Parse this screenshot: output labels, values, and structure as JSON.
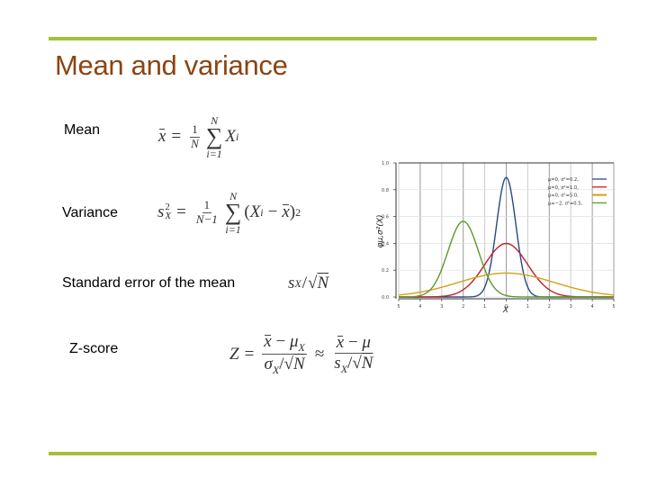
{
  "slide": {
    "title": "Mean and variance",
    "accent_color": "#a3c03c",
    "title_color": "#8b4513"
  },
  "items": [
    {
      "label": "Mean",
      "formula": "x̄ = (1/N) Σ_{i=1}^{N} X_i"
    },
    {
      "label": "Variance",
      "formula": "s_X^2 = (1/(N−1)) Σ_{i=1}^{N} (X_i − x̄)^2"
    },
    {
      "label": "Standard error of the mean",
      "formula": "s_X/√N"
    },
    {
      "label": "Z-score",
      "formula": "Z = (x̄ − μ_X)/(σ_X/√N) ≈ (x̄ − μ)/(s_X/√N)"
    }
  ],
  "formula_parts": {
    "xbar": "x",
    "eq": "=",
    "one": "1",
    "N": "N",
    "Nm1": "N−1",
    "sum_lower": "i=1",
    "sum_upper": "N",
    "sigma": "∑",
    "X": "X",
    "i": "i",
    "s": "s",
    "two": "2",
    "minus": "−",
    "lparen": "(",
    "rparen": ")",
    "slash": "/",
    "sqrt": "√",
    "Z": "Z",
    "mu": "μ",
    "sigma_lower": "σ",
    "approx": "≈"
  },
  "chart_data": {
    "type": "line",
    "title": "",
    "xlabel": "X",
    "ylabel": "φμ,σ²(X)",
    "xlim": [
      -5,
      5
    ],
    "ylim": [
      0.0,
      1.0
    ],
    "xticks": [
      -5,
      -4,
      -3,
      -2,
      -1,
      0,
      1,
      2,
      3,
      4,
      5
    ],
    "xtick_labels": [
      "5",
      "4",
      "3",
      "2",
      "1",
      "0",
      "1",
      "2",
      "3",
      "4",
      "5"
    ],
    "yticks": [
      0.0,
      0.2,
      0.4,
      0.6,
      0.8,
      1.0
    ],
    "ytick_labels": [
      "0.0",
      "0.2",
      "0.4",
      "0.6",
      "0.8",
      "1.0"
    ],
    "grid": true,
    "legend_position": "top-right",
    "series": [
      {
        "name": "μ=0, σ²=0.2,",
        "mu": 0,
        "variance": 0.2,
        "color": "#2b4a7e",
        "peak": 0.89
      },
      {
        "name": "μ=0, σ²=1.0,",
        "mu": 0,
        "variance": 1.0,
        "color": "#c0202a",
        "peak": 0.4
      },
      {
        "name": "μ=0, σ²=5.0,",
        "mu": 0,
        "variance": 5.0,
        "color": "#d4a017",
        "peak": 0.18
      },
      {
        "name": "μ=−2, σ²=0.5,",
        "mu": -2,
        "variance": 0.5,
        "color": "#5a9a2a",
        "peak": 0.56
      }
    ]
  }
}
